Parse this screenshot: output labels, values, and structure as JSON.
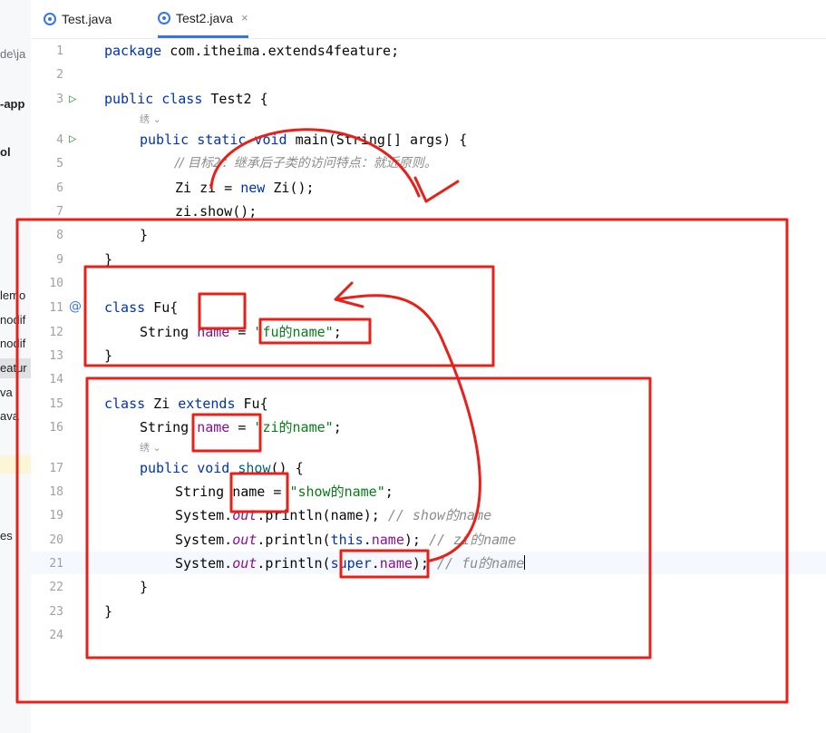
{
  "sidebar": {
    "items": [
      {
        "label": "de\\ja",
        "top": 0
      },
      {
        "label": "-app",
        "bold": true
      },
      {
        "label": "ol",
        "bold": true
      },
      {
        "label": "lemo"
      },
      {
        "label": "nodif"
      },
      {
        "label": "nodif"
      },
      {
        "label": "eatur"
      },
      {
        "label": "va"
      },
      {
        "label": "ava"
      },
      {
        "label": "es"
      }
    ]
  },
  "tabs": [
    {
      "label": "Test.java",
      "active": false
    },
    {
      "label": "Test2.java",
      "active": true,
      "close": "×"
    }
  ],
  "editor": {
    "line_numbers": [
      "1",
      "2",
      "3",
      "4",
      "5",
      "6",
      "7",
      "8",
      "9",
      "10",
      "11",
      "12",
      "13",
      "14",
      "15",
      "16",
      "17",
      "18",
      "19",
      "20",
      "21",
      "22",
      "23",
      "24"
    ],
    "inlay_hints": [
      "绣 ⌄",
      "绣 ⌄"
    ],
    "code": {
      "l1": {
        "kw": "package",
        "rest": " com.itheima.extends4feature;"
      },
      "l3": {
        "kw1": "public",
        "kw2": "class",
        "rest": " Test2 {"
      },
      "l4": {
        "kw": "public static void",
        "rest": " main(String[] args) {"
      },
      "l5": "// 目标2：继承后子类的访问特点：就近原则。",
      "l6": {
        "a": "Zi zi = ",
        "kw": "new",
        "b": " Zi();"
      },
      "l7": "zi.show();",
      "l8": "}",
      "l9": "}",
      "l11": {
        "kw": "class",
        "rest": " Fu{"
      },
      "l12": {
        "type": "String ",
        "field": "name",
        "eq": " = ",
        "str": "\"fu的name\"",
        "end": ";"
      },
      "l13": "}",
      "l15": {
        "kw": "class",
        "name": " Zi ",
        "kw2": "extends",
        "rest": " Fu{"
      },
      "l16": {
        "type": "String ",
        "field": "name",
        "eq": " = ",
        "str": "\"zi的name\"",
        "end": ";"
      },
      "l17": {
        "kw": "public void",
        "method": " show",
        "rest": "() {"
      },
      "l18": {
        "type": "String ",
        "var": "name",
        "eq": " = ",
        "str": "\"show的name\"",
        "end": ";"
      },
      "l19": {
        "a": "System.",
        "st": "out",
        "b": ".println(name); ",
        "cmt": "// show的name"
      },
      "l20": {
        "a": "System.",
        "st": "out",
        "b": ".println(",
        "kw": "this",
        "c": ".",
        "field": "name",
        "d": "); ",
        "cmt": "// zi的name"
      },
      "l21": {
        "a": "System.",
        "st": "out",
        "b": ".println(",
        "kw": "super",
        "c": ".",
        "field": "name",
        "d": "); ",
        "cmt": "// fu的name"
      },
      "l22": "}",
      "l23": "}"
    }
  },
  "colors": {
    "keyword": "#0033b3",
    "field": "#871094",
    "string": "#067d17",
    "comment": "#8c8c8c",
    "annotation_red": "#e8201a",
    "tab_accent": "#3574f0"
  },
  "icons": [
    "java-class-icon",
    "run-gutter-icon",
    "override-gutter-icon",
    "close-icon"
  ]
}
